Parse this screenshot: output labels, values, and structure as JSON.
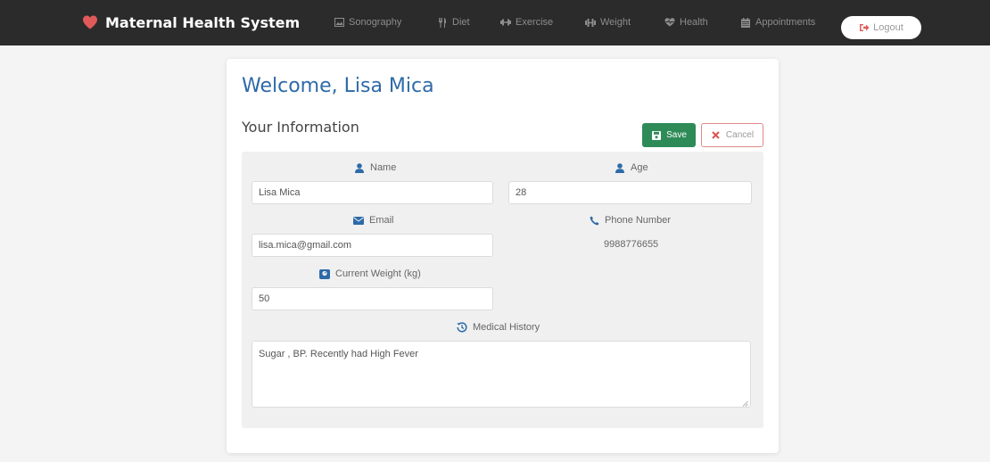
{
  "app": {
    "brand_title": "Maternal Health System",
    "brand_color": "#e05a5a"
  },
  "nav": {
    "items": [
      {
        "label": "Sonography",
        "icon": "image-icon"
      },
      {
        "label": "Diet",
        "icon": "utensils-icon"
      },
      {
        "label": "Exercise",
        "icon": "dumbbell-icon"
      },
      {
        "label": "Weight",
        "icon": "weight-icon"
      },
      {
        "label": "Health",
        "icon": "heart-pulse-icon"
      },
      {
        "label": "Appointments",
        "icon": "calendar-icon"
      }
    ],
    "logout_label": "Logout"
  },
  "page": {
    "welcome": "Welcome, Lisa Mica",
    "section_title": "Your Information",
    "save_label": "Save",
    "cancel_label": "Cancel"
  },
  "form": {
    "name": {
      "label": "Name",
      "value": "Lisa Mica"
    },
    "age": {
      "label": "Age",
      "value": "28"
    },
    "email": {
      "label": "Email",
      "value": "lisa.mica@gmail.com"
    },
    "phone": {
      "label": "Phone Number",
      "value": "9988776655"
    },
    "weight": {
      "label": "Current Weight (kg)",
      "value": "50"
    },
    "medical_history": {
      "label": "Medical History",
      "value": "Sugar , BP. Recently had High Fever"
    }
  },
  "colors": {
    "accent": "#2d6aa8",
    "save": "#2e8b57",
    "cancel_border": "#e08a8a",
    "icon_blue": "#2d6aa8"
  }
}
